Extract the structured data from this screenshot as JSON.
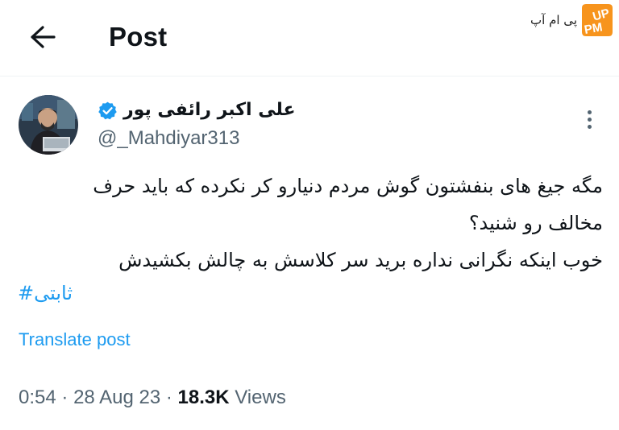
{
  "header": {
    "title": "Post"
  },
  "watermark": {
    "text": "پی ام آپ",
    "logo_text": "UP PM"
  },
  "author": {
    "name": "علی اکبر رائفی پور",
    "handle": "@_Mahdiyar313",
    "verified_color": "#1d9bf0"
  },
  "tweet": {
    "lines": [
      "مگه جیغ های بنفشتون گوش مردم دنیارو کر نکرده که باید حرف",
      "مخالف رو شنید؟",
      "خوب اینکه نگرانی نداره برید سر کلاسش به چالش بکشیدش"
    ],
    "hashtag": "ثابتی#",
    "translate_label": "Translate post"
  },
  "meta": {
    "time": "0:54",
    "separator": "·",
    "date": "28 Aug 23",
    "views_count": "18.3K",
    "views_label": "Views"
  },
  "colors": {
    "accent": "#1d9bf0",
    "secondary_text": "#536471",
    "primary_text": "#0f1419",
    "watermark_orange": "#f7941d"
  }
}
